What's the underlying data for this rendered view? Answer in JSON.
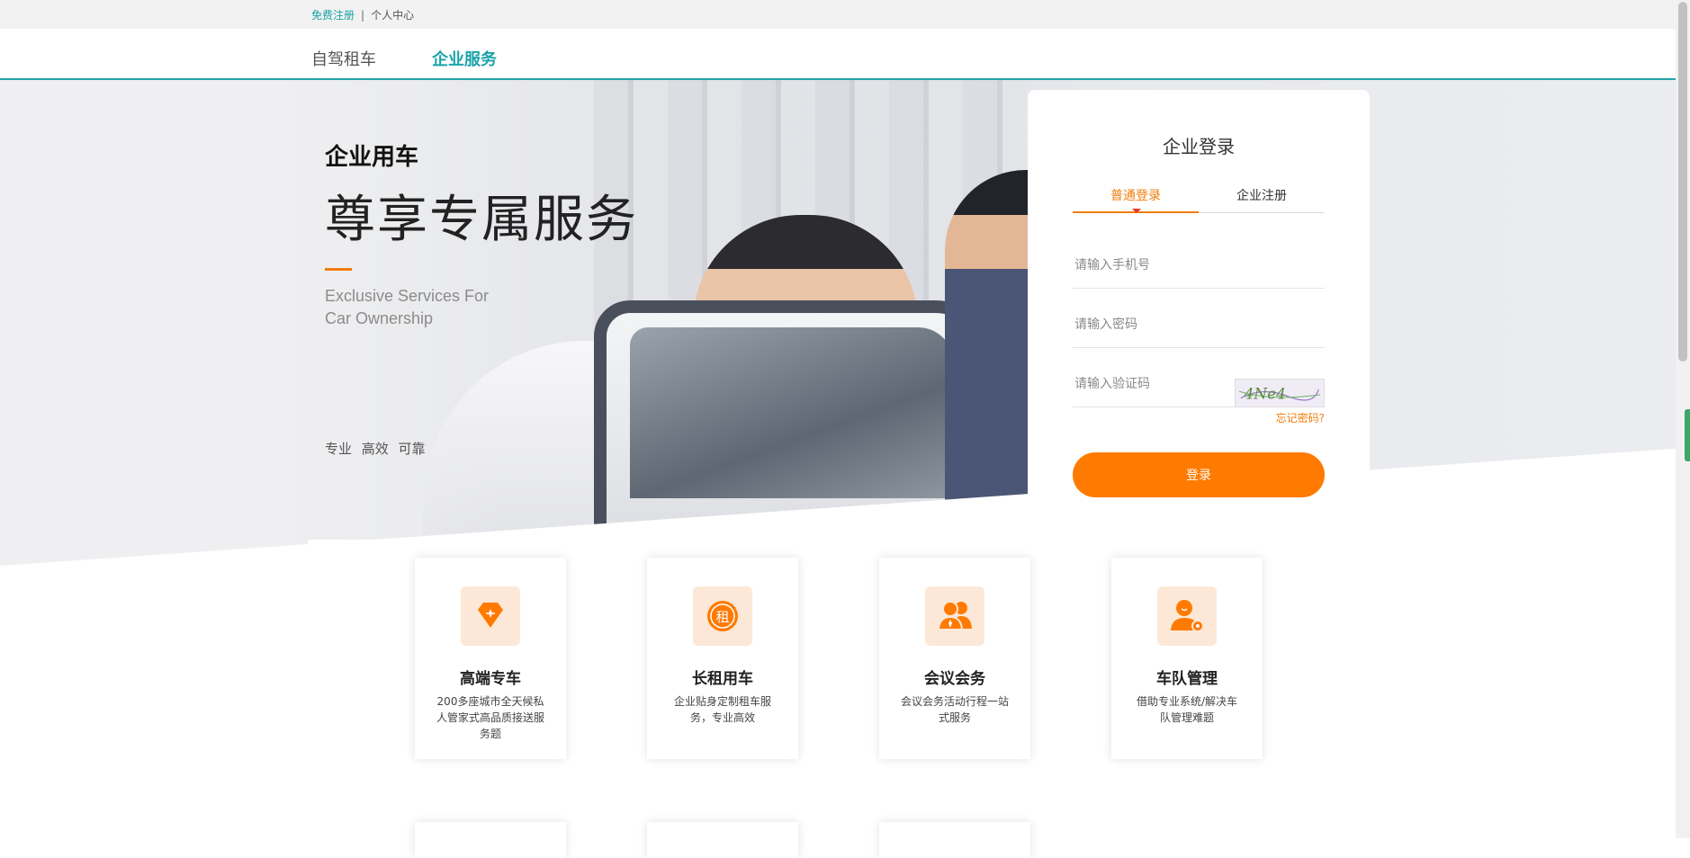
{
  "topbar": {
    "register": "免费注册",
    "separator": "|",
    "personal_center": "个人中心"
  },
  "nav": {
    "tabs": [
      {
        "label": "自驾租车",
        "active": false
      },
      {
        "label": "企业服务",
        "active": true
      }
    ]
  },
  "hero": {
    "title_small": "企业用车",
    "title_big": "尊享专属服务",
    "subtitle_en": "Exclusive Services For Car Ownership",
    "tags": "专业  高效  可靠"
  },
  "login": {
    "title": "企业登录",
    "tabs": [
      {
        "label": "普通登录",
        "active": true
      },
      {
        "label": "企业注册",
        "active": false
      }
    ],
    "phone_placeholder": "请输入手机号",
    "password_placeholder": "请输入密码",
    "captcha_placeholder": "请输入验证码",
    "captcha_text": "4Ne4",
    "forgot": "忘记密码?",
    "submit": "登录"
  },
  "services": [
    {
      "icon": "diamond-icon",
      "title": "高端专车",
      "desc": "200多座城市全天候私人管家式高品质接送服务题"
    },
    {
      "icon": "rent-icon",
      "title": "长租用车",
      "desc": "企业贴身定制租车服务，专业高效"
    },
    {
      "icon": "meeting-icon",
      "title": "会议会务",
      "desc": "会议会务活动行程一站式服务"
    },
    {
      "icon": "fleet-manager-icon",
      "title": "车队管理",
      "desc": "借助专业系统/解决车队管理难题"
    }
  ],
  "colors": {
    "accent": "#1aa3a8",
    "orange": "#ff7a00",
    "icon_bg": "#fde8d7"
  }
}
